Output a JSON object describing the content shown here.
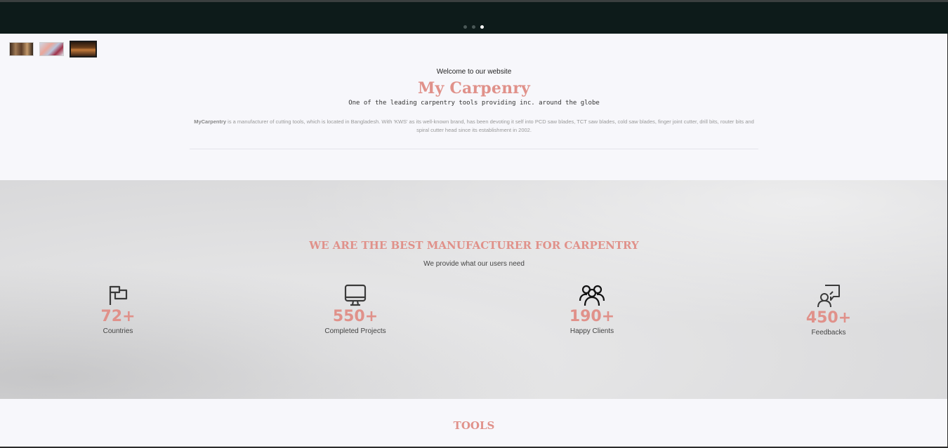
{
  "carousel": {
    "dots": [
      "slide-1",
      "slide-2",
      "slide-3"
    ],
    "active_index": 2,
    "thumbnails": [
      "thumbnail-1",
      "thumbnail-2",
      "thumbnail-3"
    ]
  },
  "intro": {
    "welcome": "Welcome to our website",
    "title": "My Carpenry",
    "tagline": "One of the leading carpentry tools providing inc. around the globe",
    "description_brand": "MyCarpentry",
    "description_text": " is a manufacturer of cutting tools, which is located in Bangladesh. With 'KWS' as its well-known brand, has been devoting it self into PCD saw blades, TCT saw blades, cold saw blades, finger joint cutter, drill bits, router bits and spiral cutter head since its establishment in 2002."
  },
  "stats": {
    "title": "WE ARE THE BEST MANUFACTURER FOR CARPENTRY",
    "subtitle": "We provide what our users need",
    "items": [
      {
        "icon": "flag-icon",
        "value": "72+",
        "label": "Countries"
      },
      {
        "icon": "monitor-icon",
        "value": "550+",
        "label": "Completed Projects"
      },
      {
        "icon": "users-icon",
        "value": "190+",
        "label": "Happy Clients"
      },
      {
        "icon": "feedback-icon",
        "value": "450+",
        "label": "Feedbacks"
      }
    ]
  },
  "tools": {
    "title": "TOOLS"
  },
  "colors": {
    "accent": "#e0918a",
    "hero_bg": "#0d1b1a",
    "page_bg": "#f7f7fb"
  }
}
